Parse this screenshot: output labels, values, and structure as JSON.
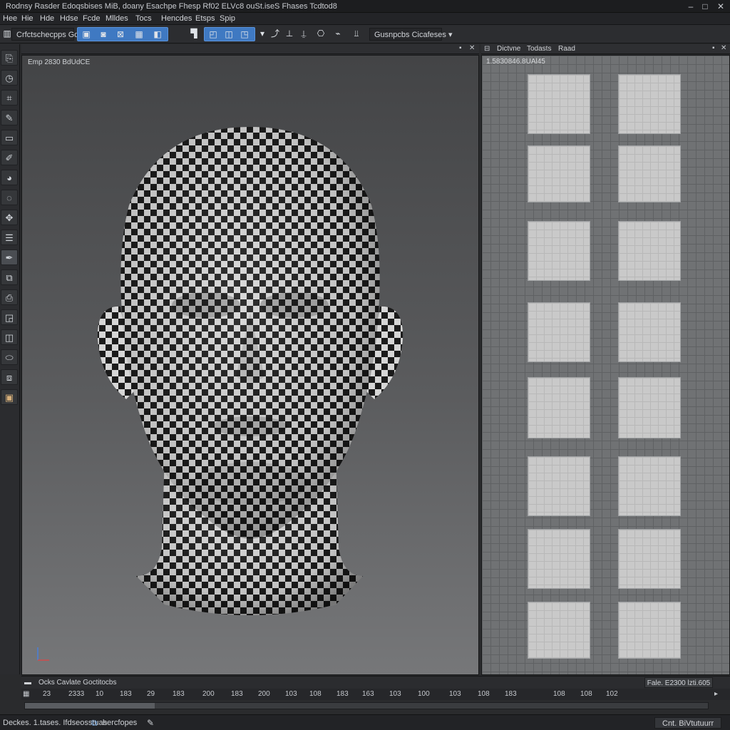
{
  "window": {
    "title": "Rodnsy Rasder Edoqsbises MiB, doany Esachpe Fhesp Rf02 ELVc8 ouSt.iseS Fhases Tcdtod8",
    "minimize": "–",
    "maximize": "□",
    "close": "✕"
  },
  "menu": [
    "Hee",
    "Hie",
    "Hde",
    "Hdse",
    "Fcde",
    "Mlldes",
    "Tocs",
    "Hencdes",
    "Etsps",
    "Spip"
  ],
  "toolbar": {
    "mode_dropdown": "Crfctschecpps Gdt",
    "mode_arrow": "▾",
    "group1_icons": [
      "select-icon",
      "camera-icon",
      "move-icon",
      "grid-icon",
      "scale-icon"
    ],
    "group2_icons": [
      "lasso-icon",
      "lock-icon",
      "cube-icon"
    ],
    "extra_icons": [
      "arrow-icon",
      "align-icon",
      "pin-icon",
      "stamp-icon",
      "link-icon",
      "chart-icon"
    ],
    "chooser": "Gusnpcbs Cicafeses",
    "chooser_arrow": "▾"
  },
  "left_tools": [
    "select",
    "rotate",
    "cut",
    "brush",
    "box",
    "pencil",
    "fill",
    "lasso",
    "move",
    "list",
    "pen",
    "copy",
    "stamp",
    "frame",
    "split",
    "eraser",
    "layers",
    "image"
  ],
  "viewport": {
    "label": "Emp 2830 BdUdCE",
    "close_icon": "✕"
  },
  "uv_panel": {
    "tabs": [
      "Dictvne",
      "Todasts",
      "Raad"
    ],
    "label": "1.5830846.8UAl45",
    "close_icon": "✕"
  },
  "timeline": {
    "title": "Ocks Cavlate Goctitocbs",
    "ticks": [
      "23",
      "2333",
      "10",
      "183",
      "29",
      "183",
      "200",
      "183",
      "200",
      "103",
      "108",
      "183",
      "163",
      "103",
      "100",
      "103",
      "108",
      "183",
      "108",
      "108",
      "102"
    ],
    "frame_display": "Fale. E2300 lzti.605",
    "progress": 0.19
  },
  "status": {
    "left_text": "Deckes. 1.tases. Ifdseosstuas",
    "tab_label": "hercfopes",
    "right_button": "Cnt. BiVtutuurr"
  },
  "colors": {
    "accent": "#3f79c2",
    "viewport_bg": "#5b5c5e",
    "checker_dark": "#1b1b1b",
    "checker_light": "#d6d6d6"
  }
}
